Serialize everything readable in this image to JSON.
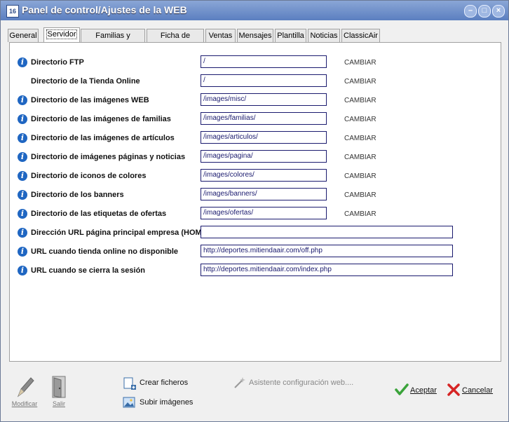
{
  "window": {
    "title": "Panel de control/Ajustes de la WEB",
    "app_badge": "16"
  },
  "window_buttons": {
    "minimize": "–",
    "maximize": "□",
    "close": "×"
  },
  "tabs": [
    {
      "label": "General"
    },
    {
      "label": "Servidor",
      "active": true
    },
    {
      "label": "Familias y artículos"
    },
    {
      "label": "Ficha de artículo"
    },
    {
      "label": "Ventas"
    },
    {
      "label": "Mensajes"
    },
    {
      "label": "Plantilla"
    },
    {
      "label": "Noticias"
    },
    {
      "label": "ClassicAir"
    }
  ],
  "rows": [
    {
      "label": "Directorio FTP",
      "value": "/",
      "action": "CAMBIAR",
      "info": true
    },
    {
      "label": "Directorio de la Tienda Online",
      "value": "/",
      "action": "CAMBIAR",
      "info": false
    },
    {
      "label": "Directorio de las imágenes WEB",
      "value": "/images/misc/",
      "action": "CAMBIAR",
      "info": true
    },
    {
      "label": "Directorio de las imágenes de familias",
      "value": "/images/familias/",
      "action": "CAMBIAR",
      "info": true
    },
    {
      "label": "Directorio de las imágenes de artículos",
      "value": "/images/articulos/",
      "action": "CAMBIAR",
      "info": true
    },
    {
      "label": "Directorio de imágenes páginas y noticias",
      "value": "/images/pagina/",
      "action": "CAMBIAR",
      "info": true
    },
    {
      "label": "Directorio de iconos de colores",
      "value": "/images/colores/",
      "action": "CAMBIAR",
      "info": true
    },
    {
      "label": "Directorio de los banners",
      "value": "/images/banners/",
      "action": "CAMBIAR",
      "info": true
    },
    {
      "label": "Directorio de las etiquetas de ofertas",
      "value": "/images/ofertas/",
      "action": "CAMBIAR",
      "info": true
    },
    {
      "label": "Dirección URL página principal empresa (HOME)",
      "value": "",
      "action": "",
      "info": true
    },
    {
      "label": "URL cuando tienda online no disponible",
      "value": "http://deportes.mitiendaair.com/off.php",
      "action": "",
      "info": true
    },
    {
      "label": "URL cuando se cierra la sesión",
      "value": "http://deportes.mitiendaair.com/index.php",
      "action": "",
      "info": true
    }
  ],
  "info_glyph": "i",
  "toolbar": {
    "modify": "Modificar",
    "exit": "Salir",
    "create_files": "Crear ficheros",
    "upload_images": "Subir imágenes",
    "wizard": "Asistente configuración web....",
    "accept": "Aceptar",
    "cancel": "Cancelar"
  },
  "colors": {
    "titlebar": "#5b7fc0",
    "info": "#1f66c2",
    "field_border": "#1a1a6e",
    "accept": "#3aa33a",
    "cancel": "#d62424"
  }
}
